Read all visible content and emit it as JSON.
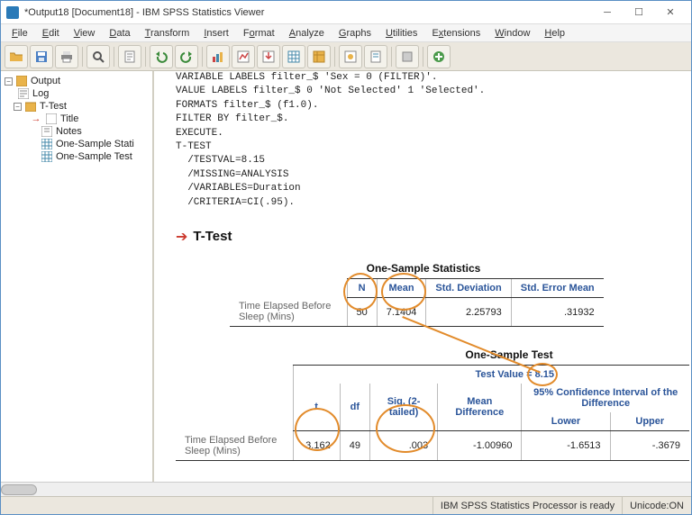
{
  "window": {
    "title": "*Output18 [Document18] - IBM SPSS Statistics Viewer"
  },
  "menu": [
    "File",
    "Edit",
    "View",
    "Data",
    "Transform",
    "Insert",
    "Format",
    "Analyze",
    "Graphs",
    "Utilities",
    "Extensions",
    "Window",
    "Help"
  ],
  "tree": {
    "root": "Output",
    "items": [
      "Log",
      "T-Test"
    ],
    "ttest_children": [
      "Title",
      "Notes",
      "One-Sample Stati",
      "One-Sample Test"
    ]
  },
  "syntax": "VARIABLE LABELS filter_$ 'Sex = 0 (FILTER)'.\nVALUE LABELS filter_$ 0 'Not Selected' 1 'Selected'.\nFORMATS filter_$ (f1.0).\nFILTER BY filter_$.\nEXECUTE.\nT-TEST\n  /TESTVAL=8.15\n  /MISSING=ANALYSIS\n  /VARIABLES=Duration\n  /CRITERIA=CI(.95).",
  "ttest_heading": "T-Test",
  "stats": {
    "caption": "One-Sample Statistics",
    "cols": {
      "n": "N",
      "mean": "Mean",
      "sd": "Std. Deviation",
      "se": "Std. Error Mean"
    },
    "row_label": "Time Elapsed Before Sleep (Mins)",
    "n": "50",
    "mean": "7.1404",
    "sd": "2.25793",
    "se": ".31932"
  },
  "test": {
    "caption": "One-Sample Test",
    "testval": "Test Value = 8.15",
    "cols": {
      "t": "t",
      "df": "df",
      "sig": "Sig. (2-tailed)",
      "md": "Mean Difference",
      "ci": "95% Confidence Interval of the Difference",
      "lower": "Lower",
      "upper": "Upper"
    },
    "row_label": "Time Elapsed Before Sleep (Mins)",
    "t": "-3.162",
    "df": "49",
    "sig": ".003",
    "md": "-1.00960",
    "lower": "-1.6513",
    "upper": "-.3679"
  },
  "status": {
    "processor": "IBM SPSS Statistics Processor is ready",
    "unicode": "Unicode:ON"
  }
}
